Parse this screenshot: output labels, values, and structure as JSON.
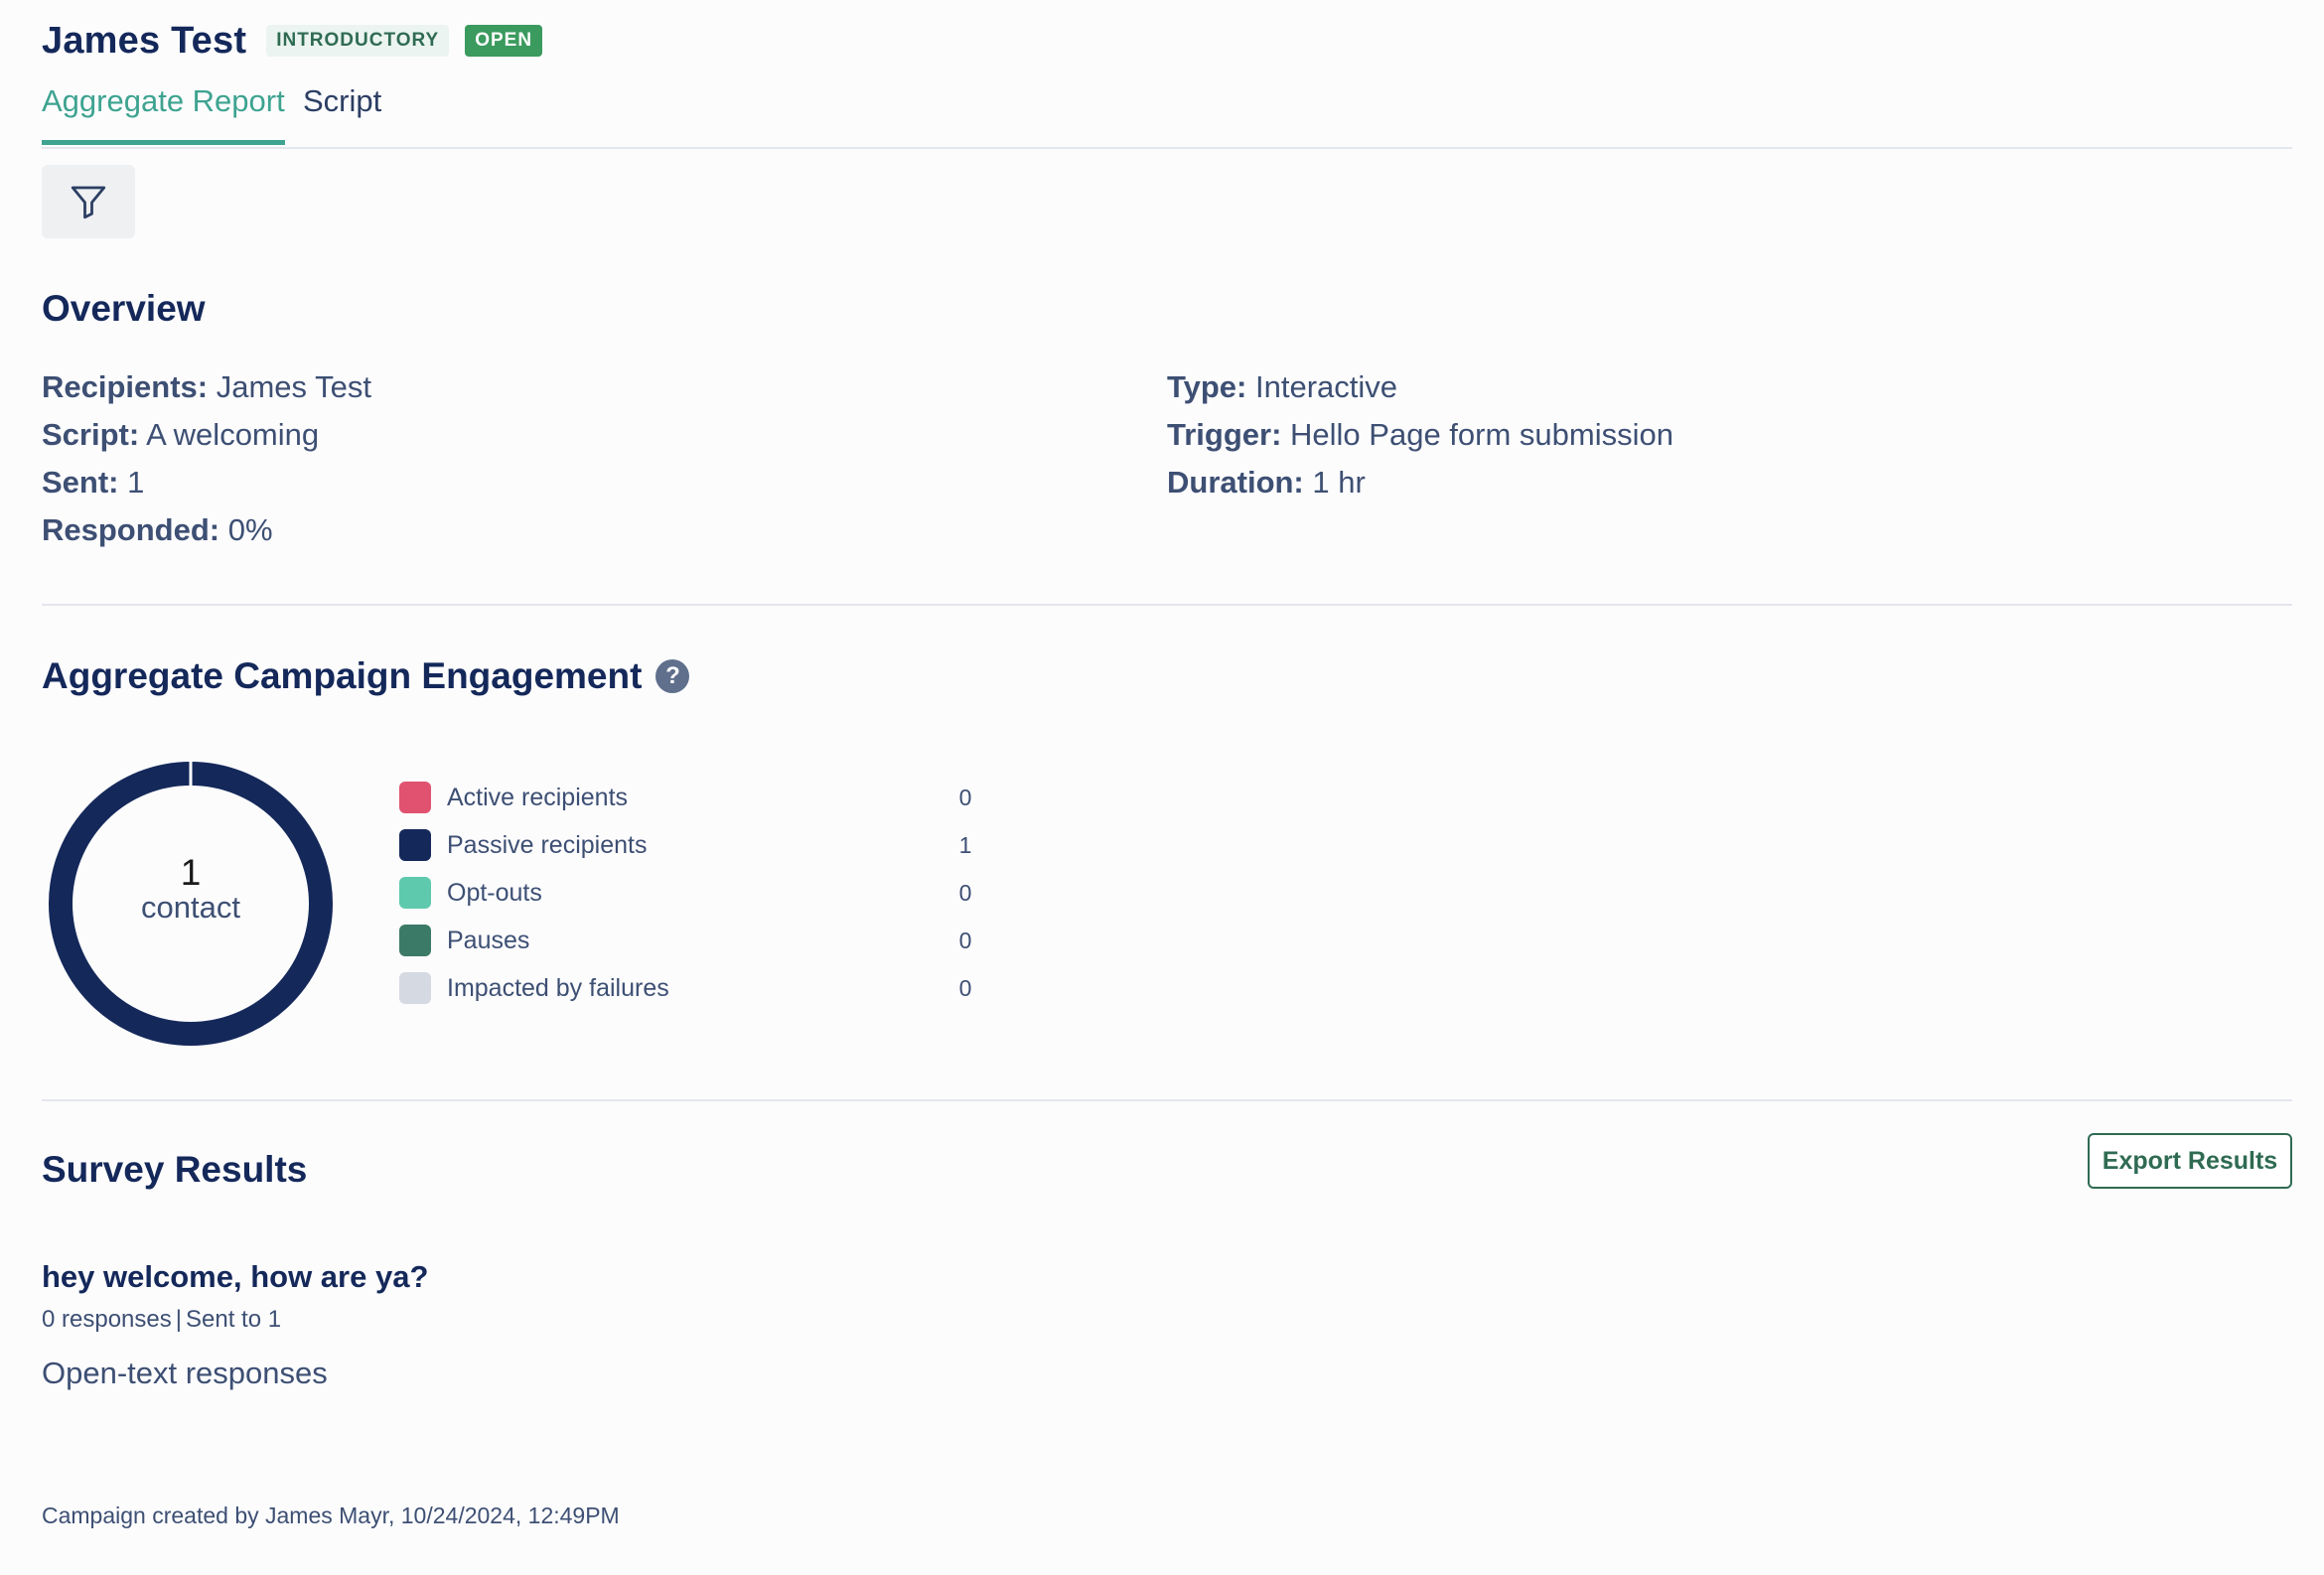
{
  "campaign": {
    "title": "James Test",
    "badges": [
      "INTRODUCTORY",
      "OPEN"
    ]
  },
  "tabs": [
    {
      "label": "Aggregate Report",
      "active": true
    },
    {
      "label": "Script",
      "active": false
    }
  ],
  "filter": {
    "icon": "filter-icon"
  },
  "overview": {
    "title": "Overview",
    "left": [
      {
        "label": "Recipients:",
        "value": "James Test"
      },
      {
        "label": "Script:",
        "value": "A welcoming"
      },
      {
        "label": "Sent:",
        "value": "1"
      },
      {
        "label": "Responded:",
        "value": "0%"
      }
    ],
    "right": [
      {
        "label": "Type:",
        "value": "Interactive"
      },
      {
        "label": "Trigger:",
        "value": "Hello Page form submission"
      },
      {
        "label": "Duration:",
        "value": "1 hr"
      }
    ]
  },
  "engagement": {
    "title": "Aggregate Campaign Engagement",
    "help_icon": "question-circle-icon",
    "total": "1",
    "total_unit": "contact",
    "legend": [
      {
        "label": "Active recipients",
        "value": "0",
        "color": "#e0526f"
      },
      {
        "label": "Passive recipients",
        "value": "1",
        "color": "#14285a"
      },
      {
        "label": "Opt-outs",
        "value": "0",
        "color": "#5ec9ac"
      },
      {
        "label": "Pauses",
        "value": "0",
        "color": "#3b7a66"
      },
      {
        "label": "Impacted by failures",
        "value": "0",
        "color": "#d5d9e2"
      }
    ]
  },
  "survey": {
    "title": "Survey Results",
    "export_label": "Export Results",
    "question": "hey welcome, how are ya?",
    "responses": "0 responses",
    "separator": "|",
    "sent": "Sent to 1",
    "open_text_label": "Open-text responses"
  },
  "footer": {
    "text": "Campaign created by James Mayr, 10/24/2024, 12:49PM"
  }
}
